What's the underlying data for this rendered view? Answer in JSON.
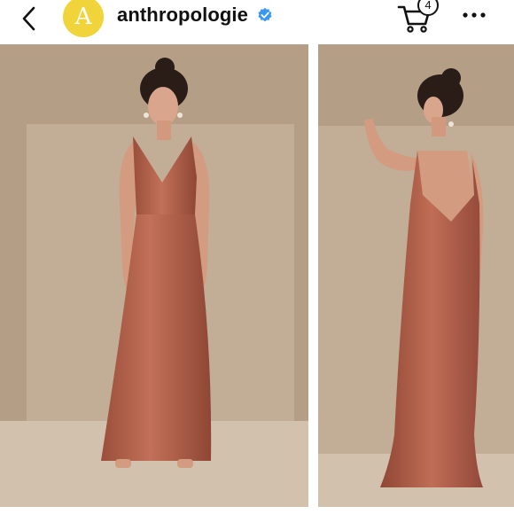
{
  "header": {
    "username": "anthropologie",
    "avatar_letter": "A",
    "cart_count": "4",
    "icons": [
      "chevron-left-icon",
      "verified-badge-icon",
      "shopping-cart-icon",
      "more-horizontal-icon"
    ]
  },
  "colors": {
    "avatar": "#f1d33a",
    "verified": "#3897f0",
    "dress": "#b9674d",
    "backdrop": "#b49e85",
    "panel": "#c2ad96",
    "floor": "#d2c1ad"
  },
  "photos": [
    {
      "label": "dress-front-view"
    },
    {
      "label": "dress-back-view"
    }
  ]
}
